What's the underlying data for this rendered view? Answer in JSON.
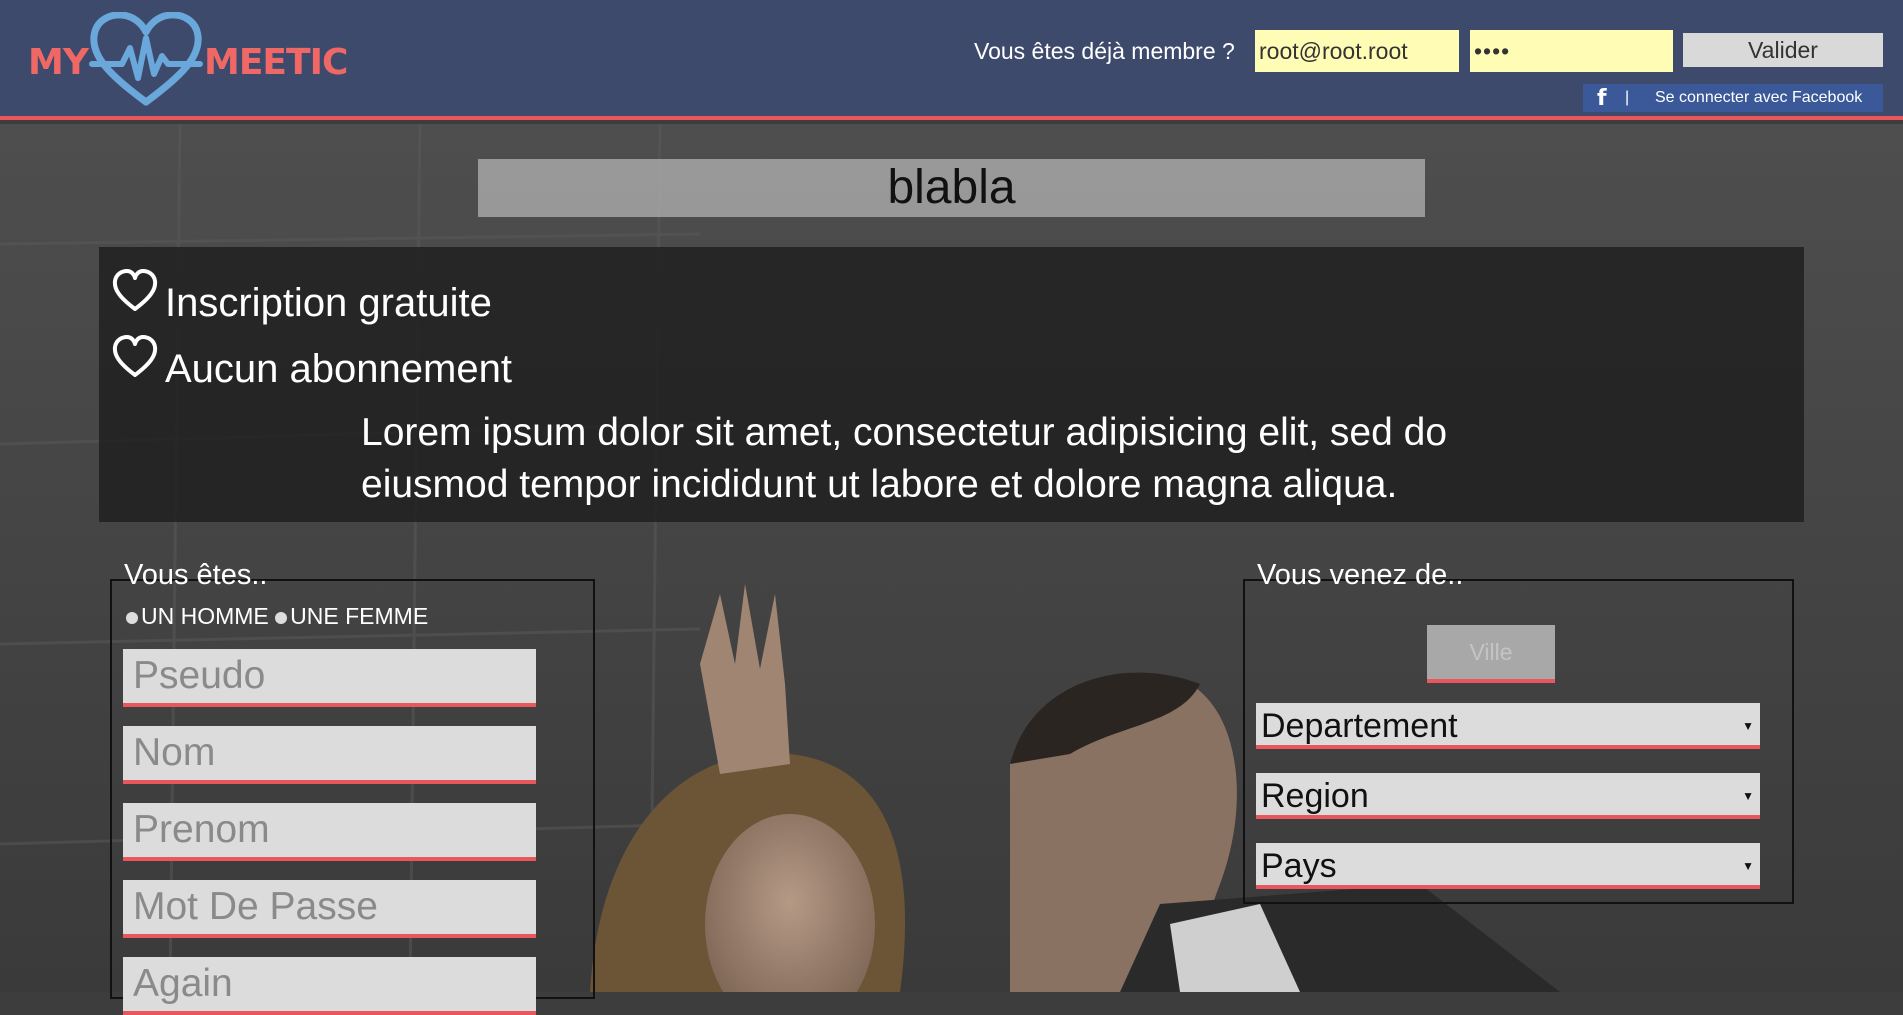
{
  "header": {
    "logo": {
      "left": "MY",
      "right": "MEETIC"
    },
    "member_label": "Vous êtes déjà membre ?",
    "email_value": "root@root.root",
    "password_value": "••••",
    "submit_label": "Valider",
    "facebook": {
      "icon": "f",
      "separator": "|",
      "label": "Se connecter avec Facebook"
    }
  },
  "title": "blabla",
  "features": {
    "items": [
      "Inscription gratuite",
      "Aucun abonnement"
    ],
    "description": "Lorem ipsum dolor sit amet, consectetur adipisicing elit, sed do eiusmod tempor incididunt ut labore et dolore magna aliqua."
  },
  "form_left": {
    "legend": "Vous êtes..",
    "gender_options": [
      "UN HOMME",
      "UNE FEMME"
    ],
    "placeholders": [
      "Pseudo",
      "Nom",
      "Prenom",
      "Mot De Passe",
      "Again"
    ]
  },
  "form_right": {
    "legend": "Vous venez de..",
    "city_button": "Ville",
    "selects": [
      "Departement",
      "Region",
      "Pays"
    ]
  },
  "colors": {
    "header_bg": "#3e4a6c",
    "accent": "#e8575b",
    "logo": "#ef6866",
    "heart": "#6aa8dc",
    "input_highlight": "#fffcb6",
    "facebook": "#3b5998"
  },
  "icons": [
    "heart-pulse-logo-icon",
    "facebook-icon",
    "heart-outline-icon",
    "dropdown-caret-icon"
  ]
}
